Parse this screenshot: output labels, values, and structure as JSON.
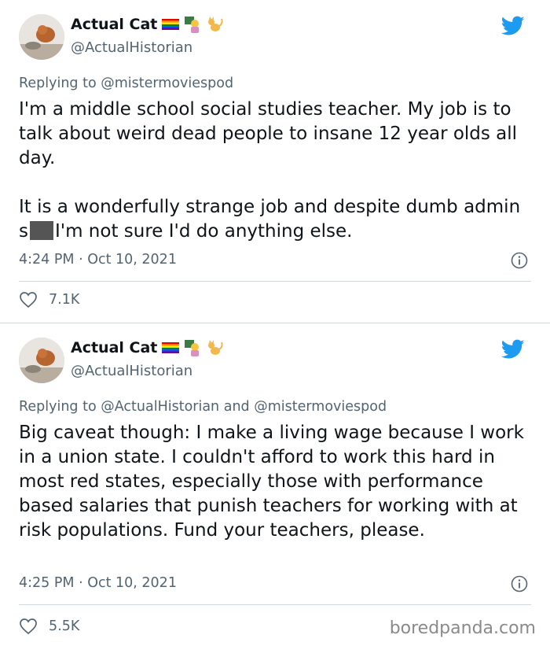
{
  "tweets": [
    {
      "display_name": "Actual Cat",
      "handle": "@ActualHistorian",
      "replying_label": "Replying to",
      "replying_to": "@mistermoviespod",
      "replying_to_2": "",
      "replying_and": "",
      "body_part1": "I'm a middle school social studies teacher. My job is to talk about weird dead people to insane 12 year olds all day.\n\nIt is a wonderfully strange job and despite dumb admin s",
      "body_part2": "I'm not sure I'd do anything else.",
      "time": "4:24 PM · Oct 10, 2021",
      "likes": "7.1K"
    },
    {
      "display_name": "Actual Cat",
      "handle": "@ActualHistorian",
      "replying_label": "Replying to",
      "replying_to": "@ActualHistorian",
      "replying_and": "and",
      "replying_to_2": "@mistermoviespod",
      "body_part1": "Big caveat though: I make a living wage because I work in a union state. I couldn't afford to work this hard in most red states, especially those with performance based salaries that punish teachers for working with at risk populations. Fund your teachers, please.",
      "body_part2": "",
      "time": "4:25 PM · Oct 10, 2021",
      "likes": "5.5K"
    }
  ],
  "watermark": "boredpanda.com",
  "colors": {
    "twitter_blue": "#1d9bf0",
    "muted": "#536471",
    "text": "#0f1419"
  },
  "icons": [
    "twitter-bird-icon",
    "info-icon",
    "heart-icon",
    "rainbow-flag-icon",
    "teacher-emoji-icon",
    "cat-emoji-icon"
  ]
}
